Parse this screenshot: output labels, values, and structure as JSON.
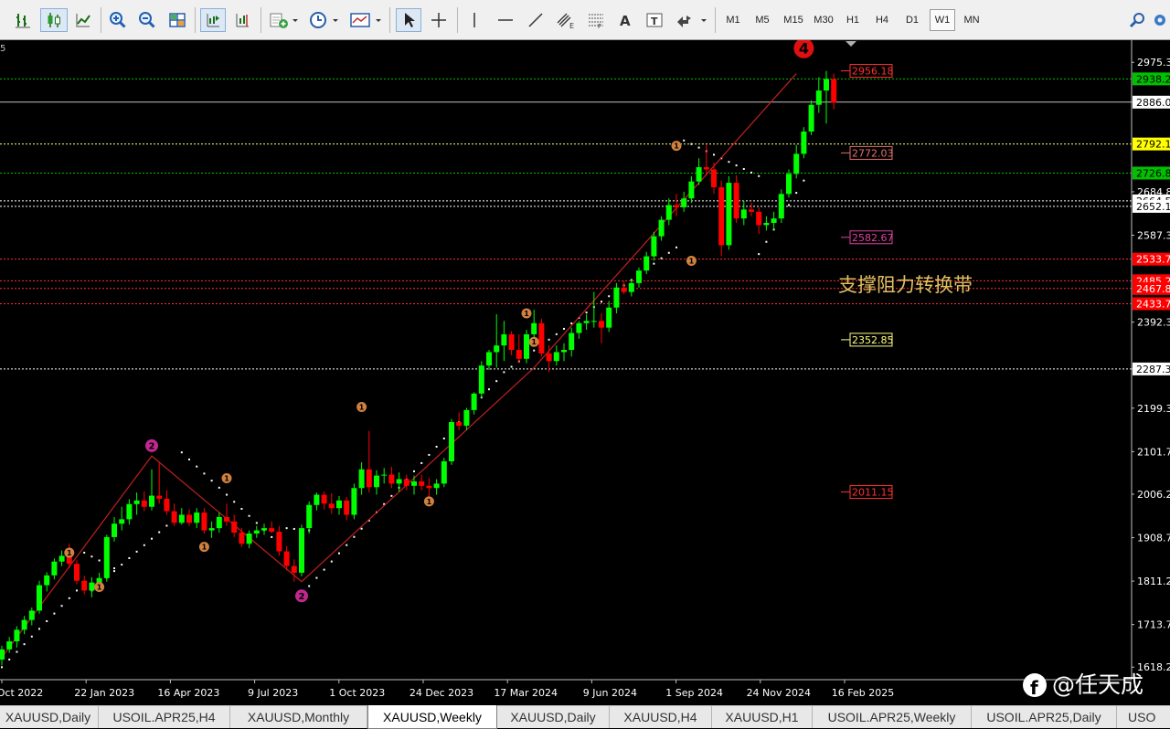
{
  "toolbar": {
    "buttons": [
      {
        "name": "bar-chart-icon"
      },
      {
        "name": "candlestick-chart-icon"
      },
      {
        "name": "line-chart-icon"
      },
      {
        "name": "zoom-in-icon"
      },
      {
        "name": "zoom-out-icon"
      },
      {
        "name": "tile-windows-icon"
      },
      {
        "name": "auto-scroll-icon"
      },
      {
        "name": "chart-shift-icon"
      },
      {
        "name": "indicators-icon"
      },
      {
        "name": "periods-clock-icon"
      },
      {
        "name": "templates-icon"
      },
      {
        "name": "cursor-icon"
      },
      {
        "name": "crosshair-icon"
      },
      {
        "name": "vertical-line-icon"
      },
      {
        "name": "horizontal-line-icon"
      },
      {
        "name": "trendline-icon"
      },
      {
        "name": "equidistant-channel-icon"
      },
      {
        "name": "fibonacci-icon"
      },
      {
        "name": "text-icon"
      },
      {
        "name": "text-label-icon"
      },
      {
        "name": "arrows-icon"
      },
      {
        "name": "search-icon"
      },
      {
        "name": "settings-icon"
      }
    ],
    "timeframes": [
      "M1",
      "M5",
      "M15",
      "M30",
      "H1",
      "H4",
      "D1",
      "W1",
      "MN"
    ],
    "active_timeframe": "W1"
  },
  "chart_data": {
    "type": "candlestick",
    "symbol_fragment": "5",
    "bull_color": "#00ff00",
    "bear_color": "#ff0000",
    "x_labels": [
      "Oct 2022",
      "22 Jan 2023",
      "16 Apr 2023",
      "9 Jul 2023",
      "1 Oct 2023",
      "24 Dec 2023",
      "17 Mar 2024",
      "9 Jun 2024",
      "1 Sep 2024",
      "24 Nov 2024",
      "16 Feb 2025"
    ],
    "y_labels": [
      "2975.3",
      "2886.0",
      "2684.8",
      "2587.3",
      "2392.3",
      "2287.3",
      "2199.3",
      "2101.7",
      "2006.2",
      "1908.7",
      "1811.2",
      "1713.7",
      "1618.2"
    ],
    "ylim": [
      1590,
      3025
    ],
    "price_tags": [
      {
        "text": "2938.2",
        "value": 2938.2,
        "bg": "#00c000",
        "fg": "#000000"
      },
      {
        "text": "2886.0",
        "value": 2886.0,
        "bg": "#ffffff",
        "fg": "#000000"
      },
      {
        "text": "2792.1",
        "value": 2792.1,
        "bg": "#ffff00",
        "fg": "#000000"
      },
      {
        "text": "2726.8",
        "value": 2726.8,
        "bg": "#00c000",
        "fg": "#000000"
      },
      {
        "text": "2664.5",
        "value": 2664.5,
        "bg": "#ffffff",
        "fg": "#000000"
      },
      {
        "text": "2652.1",
        "value": 2652.1,
        "bg": "#ffffff",
        "fg": "#000000"
      },
      {
        "text": "2533.7",
        "value": 2533.7,
        "bg": "#ff0000",
        "fg": "#ffffff"
      },
      {
        "text": "2485.2",
        "value": 2485.2,
        "bg": "#ff0000",
        "fg": "#ffffff"
      },
      {
        "text": "2467.8",
        "value": 2467.8,
        "bg": "#ff0000",
        "fg": "#ffffff"
      },
      {
        "text": "2433.7",
        "value": 2433.7,
        "bg": "#ff0000",
        "fg": "#ffffff"
      },
      {
        "text": "2287.3",
        "value": 2287.3,
        "bg": "#ffffff",
        "fg": "#000000"
      }
    ],
    "hlines": [
      {
        "value": 2938.2,
        "color": "#00c000",
        "style": "dotted"
      },
      {
        "value": 2886.0,
        "color": "#c0c0c0",
        "style": "solid"
      },
      {
        "value": 2792.1,
        "color": "#ffff80",
        "style": "dotted"
      },
      {
        "value": 2726.8,
        "color": "#00c000",
        "style": "dotted"
      },
      {
        "value": 2664.5,
        "color": "#ffffff",
        "style": "dotted"
      },
      {
        "value": 2652.1,
        "color": "#ffffff",
        "style": "dotted"
      },
      {
        "value": 2533.7,
        "color": "#ff3030",
        "style": "dotted"
      },
      {
        "value": 2485.2,
        "color": "#ff3030",
        "style": "dotted"
      },
      {
        "value": 2467.8,
        "color": "#ff3030",
        "style": "dotted"
      },
      {
        "value": 2433.7,
        "color": "#ff3030",
        "style": "dotted"
      },
      {
        "value": 2287.3,
        "color": "#ffffff",
        "style": "dotted"
      }
    ],
    "level_labels": [
      {
        "text": "2956.18",
        "value": 2956.18,
        "color": "#ff3030"
      },
      {
        "text": "2772.03",
        "value": 2772.03,
        "color": "#e07070"
      },
      {
        "text": "2582.67",
        "value": 2582.67,
        "color": "#e040a0"
      },
      {
        "text": "2352.85",
        "value": 2352.85,
        "color": "#ffff80"
      },
      {
        "text": "2011.15",
        "value": 2011.15,
        "color": "#ff3030"
      }
    ],
    "annotation": {
      "text": "支撑阻力转换带",
      "color": "#e0c060"
    },
    "wave_marks": [
      {
        "label": "1",
        "kind": "small",
        "x": 9,
        "y": 1875
      },
      {
        "label": "1",
        "kind": "small",
        "x": 13,
        "y": 1798
      },
      {
        "label": "2",
        "kind": "big",
        "x": 20,
        "y": 2115
      },
      {
        "label": "1",
        "kind": "small",
        "x": 27,
        "y": 1888
      },
      {
        "label": "1",
        "kind": "small",
        "x": 30,
        "y": 2042
      },
      {
        "label": "2",
        "kind": "big",
        "x": 40,
        "y": 1778
      },
      {
        "label": "1",
        "kind": "small",
        "x": 48,
        "y": 2202
      },
      {
        "label": "1",
        "kind": "small",
        "x": 57,
        "y": 1990
      },
      {
        "label": "1",
        "kind": "small",
        "x": 70,
        "y": 2412
      },
      {
        "label": "1",
        "kind": "small",
        "x": 71,
        "y": 2348
      },
      {
        "label": "1",
        "kind": "small",
        "x": 90,
        "y": 2788
      },
      {
        "label": "1",
        "kind": "small",
        "x": 92,
        "y": 2530
      },
      {
        "label": "4",
        "kind": "red",
        "x": 107,
        "y": 3007
      }
    ],
    "candles": [
      {
        "o": 1635,
        "h": 1666,
        "l": 1622,
        "c": 1658
      },
      {
        "o": 1658,
        "h": 1686,
        "l": 1650,
        "c": 1676
      },
      {
        "o": 1676,
        "h": 1710,
        "l": 1662,
        "c": 1702
      },
      {
        "o": 1702,
        "h": 1733,
        "l": 1692,
        "c": 1724
      },
      {
        "o": 1724,
        "h": 1752,
        "l": 1712,
        "c": 1745
      },
      {
        "o": 1745,
        "h": 1812,
        "l": 1738,
        "c": 1802
      },
      {
        "o": 1802,
        "h": 1831,
        "l": 1788,
        "c": 1824
      },
      {
        "o": 1824,
        "h": 1862,
        "l": 1815,
        "c": 1855
      },
      {
        "o": 1855,
        "h": 1880,
        "l": 1845,
        "c": 1868
      },
      {
        "o": 1868,
        "h": 1895,
        "l": 1840,
        "c": 1850
      },
      {
        "o": 1850,
        "h": 1858,
        "l": 1804,
        "c": 1812
      },
      {
        "o": 1812,
        "h": 1823,
        "l": 1782,
        "c": 1790
      },
      {
        "o": 1790,
        "h": 1820,
        "l": 1775,
        "c": 1808
      },
      {
        "o": 1808,
        "h": 1830,
        "l": 1790,
        "c": 1818
      },
      {
        "o": 1818,
        "h": 1915,
        "l": 1810,
        "c": 1910
      },
      {
        "o": 1910,
        "h": 1955,
        "l": 1900,
        "c": 1940
      },
      {
        "o": 1940,
        "h": 1978,
        "l": 1925,
        "c": 1950
      },
      {
        "o": 1950,
        "h": 1995,
        "l": 1938,
        "c": 1984
      },
      {
        "o": 1984,
        "h": 2010,
        "l": 1960,
        "c": 1992
      },
      {
        "o": 1992,
        "h": 2012,
        "l": 1968,
        "c": 1978
      },
      {
        "o": 1978,
        "h": 2062,
        "l": 1970,
        "c": 2003
      },
      {
        "o": 2003,
        "h": 2078,
        "l": 1985,
        "c": 1996
      },
      {
        "o": 1996,
        "h": 2015,
        "l": 1960,
        "c": 1968
      },
      {
        "o": 1968,
        "h": 1985,
        "l": 1935,
        "c": 1942
      },
      {
        "o": 1942,
        "h": 1975,
        "l": 1938,
        "c": 1960
      },
      {
        "o": 1960,
        "h": 1972,
        "l": 1935,
        "c": 1942
      },
      {
        "o": 1942,
        "h": 1975,
        "l": 1930,
        "c": 1965
      },
      {
        "o": 1965,
        "h": 1975,
        "l": 1918,
        "c": 1925
      },
      {
        "o": 1925,
        "h": 1945,
        "l": 1908,
        "c": 1930
      },
      {
        "o": 1930,
        "h": 1965,
        "l": 1920,
        "c": 1955
      },
      {
        "o": 1955,
        "h": 1985,
        "l": 1935,
        "c": 1945
      },
      {
        "o": 1945,
        "h": 1960,
        "l": 1910,
        "c": 1920
      },
      {
        "o": 1920,
        "h": 1930,
        "l": 1888,
        "c": 1895
      },
      {
        "o": 1895,
        "h": 1925,
        "l": 1885,
        "c": 1918
      },
      {
        "o": 1918,
        "h": 1935,
        "l": 1908,
        "c": 1925
      },
      {
        "o": 1925,
        "h": 1940,
        "l": 1915,
        "c": 1930
      },
      {
        "o": 1930,
        "h": 1945,
        "l": 1918,
        "c": 1922
      },
      {
        "o": 1922,
        "h": 1935,
        "l": 1868,
        "c": 1878
      },
      {
        "o": 1878,
        "h": 1890,
        "l": 1835,
        "c": 1845
      },
      {
        "o": 1845,
        "h": 1860,
        "l": 1810,
        "c": 1830
      },
      {
        "o": 1830,
        "h": 1938,
        "l": 1822,
        "c": 1930
      },
      {
        "o": 1930,
        "h": 1990,
        "l": 1918,
        "c": 1982
      },
      {
        "o": 1982,
        "h": 2010,
        "l": 1970,
        "c": 2005
      },
      {
        "o": 2005,
        "h": 2012,
        "l": 1972,
        "c": 1985
      },
      {
        "o": 1985,
        "h": 2008,
        "l": 1962,
        "c": 1975
      },
      {
        "o": 1975,
        "h": 2002,
        "l": 1960,
        "c": 1992
      },
      {
        "o": 1992,
        "h": 2000,
        "l": 1948,
        "c": 1960
      },
      {
        "o": 1960,
        "h": 2030,
        "l": 1950,
        "c": 2020
      },
      {
        "o": 2020,
        "h": 2078,
        "l": 2005,
        "c": 2062
      },
      {
        "o": 2062,
        "h": 2148,
        "l": 2010,
        "c": 2022
      },
      {
        "o": 2022,
        "h": 2060,
        "l": 2005,
        "c": 2048
      },
      {
        "o": 2048,
        "h": 2065,
        "l": 2030,
        "c": 2050
      },
      {
        "o": 2050,
        "h": 2068,
        "l": 2020,
        "c": 2030
      },
      {
        "o": 2030,
        "h": 2055,
        "l": 2012,
        "c": 2040
      },
      {
        "o": 2040,
        "h": 2050,
        "l": 2015,
        "c": 2025
      },
      {
        "o": 2025,
        "h": 2048,
        "l": 2005,
        "c": 2035
      },
      {
        "o": 2035,
        "h": 2050,
        "l": 2015,
        "c": 2025
      },
      {
        "o": 2025,
        "h": 2042,
        "l": 1995,
        "c": 2020
      },
      {
        "o": 2020,
        "h": 2040,
        "l": 2005,
        "c": 2030
      },
      {
        "o": 2030,
        "h": 2088,
        "l": 2022,
        "c": 2080
      },
      {
        "o": 2080,
        "h": 2175,
        "l": 2072,
        "c": 2168
      },
      {
        "o": 2168,
        "h": 2190,
        "l": 2150,
        "c": 2160
      },
      {
        "o": 2160,
        "h": 2200,
        "l": 2150,
        "c": 2195
      },
      {
        "o": 2195,
        "h": 2235,
        "l": 2185,
        "c": 2232
      },
      {
        "o": 2232,
        "h": 2305,
        "l": 2222,
        "c": 2295
      },
      {
        "o": 2295,
        "h": 2330,
        "l": 2285,
        "c": 2325
      },
      {
        "o": 2325,
        "h": 2410,
        "l": 2290,
        "c": 2340
      },
      {
        "o": 2340,
        "h": 2395,
        "l": 2305,
        "c": 2365
      },
      {
        "o": 2365,
        "h": 2372,
        "l": 2318,
        "c": 2330
      },
      {
        "o": 2330,
        "h": 2365,
        "l": 2300,
        "c": 2310
      },
      {
        "o": 2310,
        "h": 2375,
        "l": 2300,
        "c": 2365
      },
      {
        "o": 2365,
        "h": 2420,
        "l": 2352,
        "c": 2390
      },
      {
        "o": 2390,
        "h": 2400,
        "l": 2315,
        "c": 2322
      },
      {
        "o": 2322,
        "h": 2340,
        "l": 2280,
        "c": 2305
      },
      {
        "o": 2305,
        "h": 2340,
        "l": 2295,
        "c": 2325
      },
      {
        "o": 2325,
        "h": 2345,
        "l": 2305,
        "c": 2330
      },
      {
        "o": 2330,
        "h": 2380,
        "l": 2315,
        "c": 2368
      },
      {
        "o": 2368,
        "h": 2395,
        "l": 2355,
        "c": 2390
      },
      {
        "o": 2390,
        "h": 2410,
        "l": 2375,
        "c": 2395
      },
      {
        "o": 2395,
        "h": 2460,
        "l": 2380,
        "c": 2395
      },
      {
        "o": 2395,
        "h": 2412,
        "l": 2345,
        "c": 2380
      },
      {
        "o": 2380,
        "h": 2440,
        "l": 2370,
        "c": 2425
      },
      {
        "o": 2425,
        "h": 2480,
        "l": 2412,
        "c": 2470
      },
      {
        "o": 2470,
        "h": 2485,
        "l": 2455,
        "c": 2460
      },
      {
        "o": 2460,
        "h": 2490,
        "l": 2450,
        "c": 2480
      },
      {
        "o": 2480,
        "h": 2515,
        "l": 2470,
        "c": 2508
      },
      {
        "o": 2508,
        "h": 2550,
        "l": 2500,
        "c": 2540
      },
      {
        "o": 2540,
        "h": 2595,
        "l": 2530,
        "c": 2585
      },
      {
        "o": 2585,
        "h": 2630,
        "l": 2575,
        "c": 2622
      },
      {
        "o": 2622,
        "h": 2670,
        "l": 2610,
        "c": 2655
      },
      {
        "o": 2655,
        "h": 2680,
        "l": 2630,
        "c": 2650
      },
      {
        "o": 2650,
        "h": 2685,
        "l": 2640,
        "c": 2670
      },
      {
        "o": 2670,
        "h": 2720,
        "l": 2660,
        "c": 2708
      },
      {
        "o": 2708,
        "h": 2760,
        "l": 2700,
        "c": 2740
      },
      {
        "o": 2740,
        "h": 2790,
        "l": 2720,
        "c": 2735
      },
      {
        "o": 2735,
        "h": 2750,
        "l": 2680,
        "c": 2695
      },
      {
        "o": 2695,
        "h": 2710,
        "l": 2540,
        "c": 2565
      },
      {
        "o": 2565,
        "h": 2720,
        "l": 2555,
        "c": 2705
      },
      {
        "o": 2705,
        "h": 2722,
        "l": 2615,
        "c": 2625
      },
      {
        "o": 2625,
        "h": 2665,
        "l": 2610,
        "c": 2645
      },
      {
        "o": 2645,
        "h": 2660,
        "l": 2630,
        "c": 2640
      },
      {
        "o": 2640,
        "h": 2650,
        "l": 2590,
        "c": 2610
      },
      {
        "o": 2610,
        "h": 2630,
        "l": 2598,
        "c": 2615
      },
      {
        "o": 2615,
        "h": 2640,
        "l": 2600,
        "c": 2625
      },
      {
        "o": 2625,
        "h": 2690,
        "l": 2615,
        "c": 2680
      },
      {
        "o": 2680,
        "h": 2735,
        "l": 2672,
        "c": 2725
      },
      {
        "o": 2725,
        "h": 2790,
        "l": 2715,
        "c": 2770
      },
      {
        "o": 2770,
        "h": 2830,
        "l": 2760,
        "c": 2820
      },
      {
        "o": 2820,
        "h": 2890,
        "l": 2812,
        "c": 2880
      },
      {
        "o": 2880,
        "h": 2942,
        "l": 2862,
        "c": 2912
      },
      {
        "o": 2912,
        "h": 2956,
        "l": 2838,
        "c": 2938
      },
      {
        "o": 2938,
        "h": 2950,
        "l": 2870,
        "c": 2885
      }
    ],
    "upper_dots": [
      {
        "from": 11,
        "to": 15,
        "start": 1875,
        "end": 1840
      },
      {
        "from": 24,
        "to": 36,
        "start": 2100,
        "end": 1910
      },
      {
        "from": 38,
        "to": 41,
        "start": 1930,
        "end": 1925
      },
      {
        "from": 91,
        "to": 101,
        "start": 2800,
        "end": 2720
      }
    ],
    "lower_dots": [
      {
        "from": 0,
        "to": 10,
        "start": 1618,
        "end": 1790
      },
      {
        "from": 12,
        "to": 23,
        "start": 1790,
        "end": 1950
      },
      {
        "from": 41,
        "to": 66,
        "start": 1800,
        "end": 2260
      },
      {
        "from": 67,
        "to": 90,
        "start": 2280,
        "end": 2560
      },
      {
        "from": 101,
        "to": 107,
        "start": 2545,
        "end": 2710
      }
    ],
    "zigzag": [
      {
        "x": 0,
        "y": 1640
      },
      {
        "x": 20,
        "y": 2092
      },
      {
        "x": 40,
        "y": 1810
      },
      {
        "x": 71,
        "y": 2290
      },
      {
        "x": 106,
        "y": 2950
      }
    ]
  },
  "watermark": {
    "text": "@任天成"
  },
  "tabs": {
    "items": [
      "XAUUSD,Daily",
      "USOIL.APR25,H4",
      "XAUUSD,Monthly",
      "XAUUSD,Weekly",
      "XAUUSD,Daily",
      "XAUUSD,H4",
      "XAUUSD,H1",
      "USOIL.APR25,Weekly",
      "USOIL.APR25,Daily",
      "USO"
    ],
    "active_index": 3
  }
}
